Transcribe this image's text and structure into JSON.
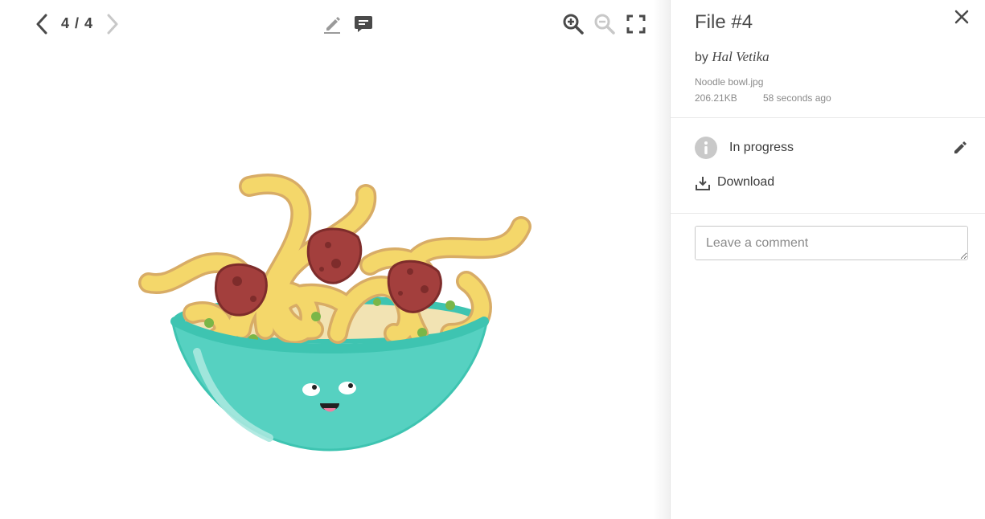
{
  "viewer": {
    "counter": "4 / 4",
    "icons": {
      "prev": "chevron-left-icon",
      "next": "chevron-right-icon",
      "annotate": "pencil-icon",
      "comments": "comment-icon",
      "zoom_in": "zoom-in-icon",
      "zoom_out": "zoom-out-icon",
      "fullscreen": "fullscreen-icon"
    },
    "next_enabled": false,
    "zoom_out_enabled": false,
    "image_subject": "noodle-bowl-illustration"
  },
  "sidebar": {
    "title": "File #4",
    "by_prefix": "by",
    "author": "Hal Vetika",
    "file_name": "Noodle bowl.jpg",
    "file_size": "206.21KB",
    "uploaded": "58 seconds ago",
    "status": "In progress",
    "download_label": "Download",
    "comment_placeholder": "Leave a comment"
  },
  "colors": {
    "bowl": "#56d1c1",
    "bowl_rim": "#3ec4b1",
    "noodle": "#f4d76a",
    "noodle_outline": "#d8ac66",
    "meatball": "#a33f3d",
    "pea": "#7ab648",
    "icon_dark": "#4a4a4a",
    "icon_disabled": "#c8c8c8"
  }
}
